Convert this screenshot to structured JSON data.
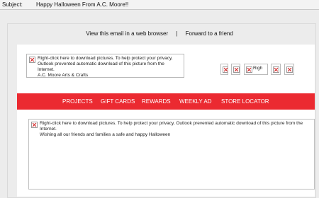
{
  "subject": {
    "label": "Subject:",
    "value": "Happy Halloween From A.C. Moore!!"
  },
  "top_links": {
    "browser_link": "View this email in a web browser",
    "separator": "|",
    "forward_link": "Forward to a friend"
  },
  "logo_image": {
    "alt_text": "Right-click here to download pictures.  To help protect your privacy, Outlook prevented automatic download of this picture from the Internet.\nA.C. Moore Arts & Crafts"
  },
  "social_images": [
    {
      "text": ""
    },
    {
      "text": ""
    },
    {
      "text": "Righ"
    },
    {
      "text": ""
    },
    {
      "text": ""
    }
  ],
  "nav": {
    "items": [
      "PROJECTS",
      "GIFT CARDS",
      "REWARDS",
      "WEEKLY AD",
      "STORE LOCATOR"
    ],
    "bg_color": "#eb2a31"
  },
  "banner_image": {
    "alt_text": "Right-click here to download pictures.  To help protect your privacy, Outlook prevented automatic download of this picture from the Internet.\nWishing all our friends and families a safe and happy Halloween"
  },
  "icons": {
    "broken_image": "broken-image-icon"
  }
}
